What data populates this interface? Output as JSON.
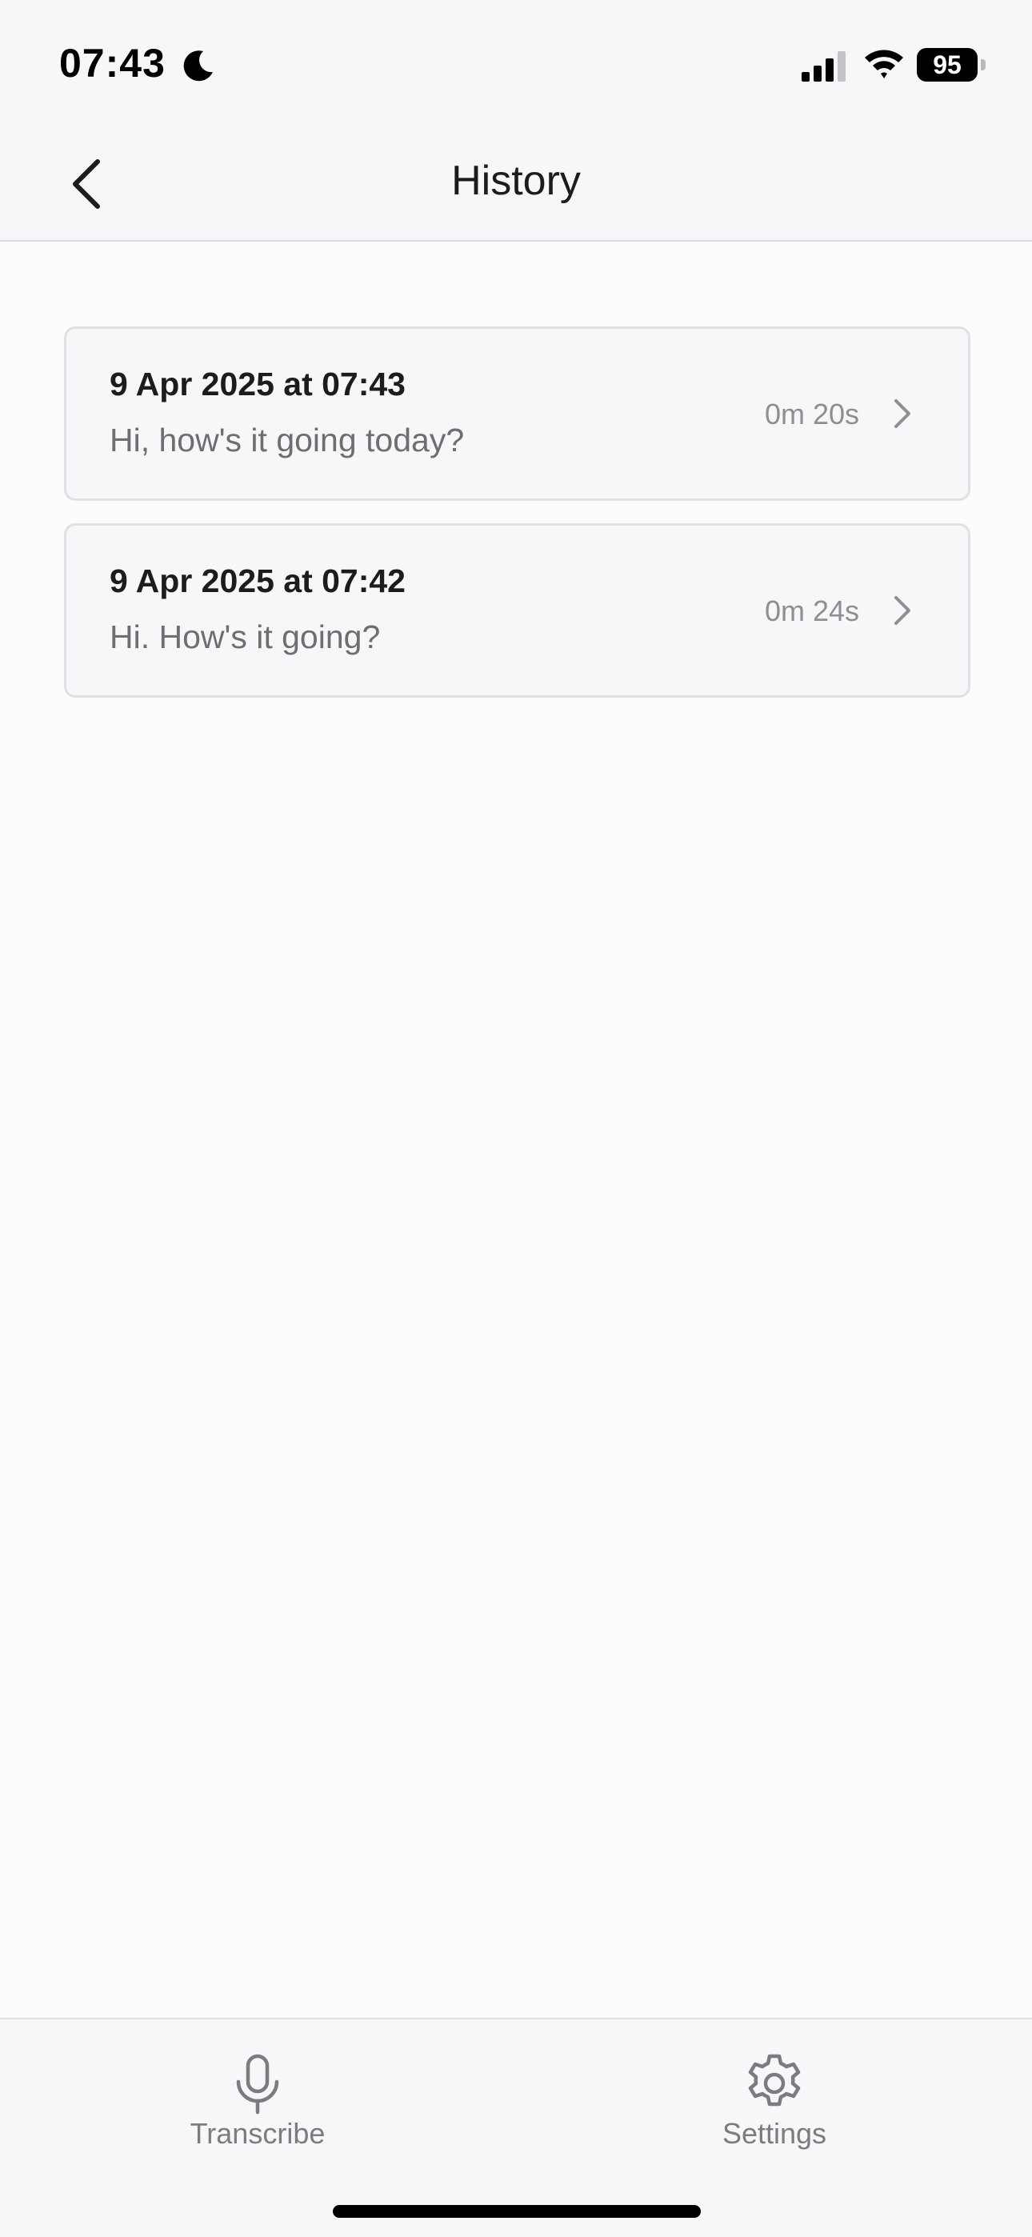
{
  "status_bar": {
    "time": "07:43",
    "battery_level": "95"
  },
  "nav": {
    "title": "History"
  },
  "history": [
    {
      "date": "9 Apr 2025 at 07:43",
      "preview": "Hi, how's it going today?",
      "duration": "0m 20s"
    },
    {
      "date": "9 Apr 2025 at 07:42",
      "preview": "Hi. How's it going?",
      "duration": "0m 24s"
    }
  ],
  "tabs": [
    {
      "label": "Transcribe",
      "icon": "microphone-icon"
    },
    {
      "label": "Settings",
      "icon": "gear-icon"
    }
  ],
  "colors": {
    "background": "#fcfcfd",
    "bar_background": "#f7f7f9",
    "card_border": "#e1e1e5",
    "primary_text": "#1c1c1e",
    "secondary_text": "#6d6d72",
    "tab_inactive": "#7b7b80"
  }
}
